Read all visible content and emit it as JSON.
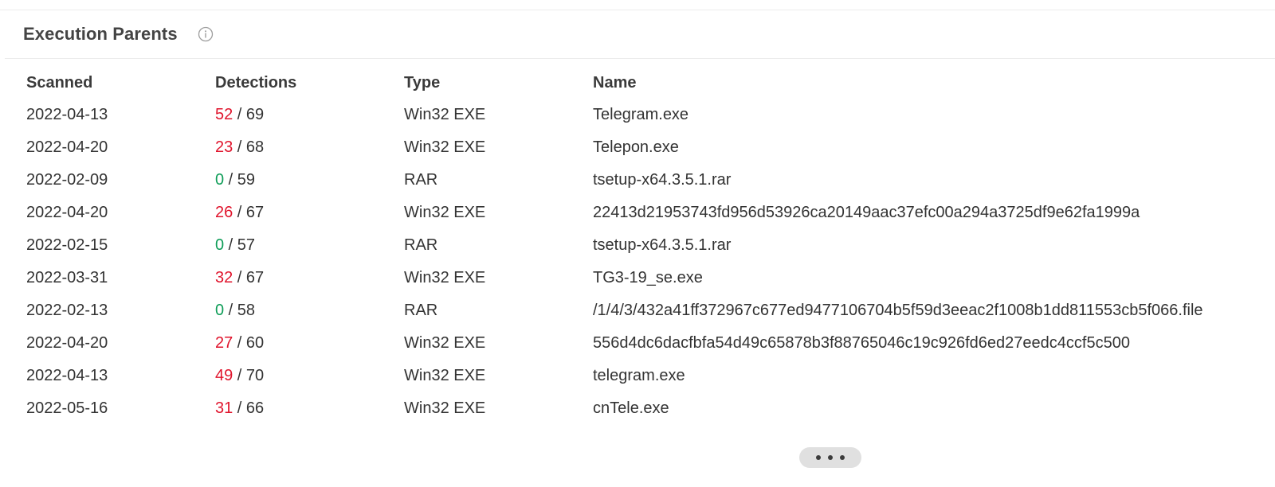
{
  "section": {
    "title": "Execution Parents",
    "info_icon": "info-circle-icon"
  },
  "table": {
    "columns": [
      "Scanned",
      "Detections",
      "Type",
      "Name"
    ],
    "rows": [
      {
        "scanned": "2022-04-13",
        "detected": "52",
        "total": "69",
        "type": "Win32 EXE",
        "name": "Telegram.exe"
      },
      {
        "scanned": "2022-04-20",
        "detected": "23",
        "total": "68",
        "type": "Win32 EXE",
        "name": "Telepon.exe"
      },
      {
        "scanned": "2022-02-09",
        "detected": "0",
        "total": "59",
        "type": "RAR",
        "name": "tsetup-x64.3.5.1.rar"
      },
      {
        "scanned": "2022-04-20",
        "detected": "26",
        "total": "67",
        "type": "Win32 EXE",
        "name": "22413d21953743fd956d53926ca20149aac37efc00a294a3725df9e62fa1999a"
      },
      {
        "scanned": "2022-02-15",
        "detected": "0",
        "total": "57",
        "type": "RAR",
        "name": "tsetup-x64.3.5.1.rar"
      },
      {
        "scanned": "2022-03-31",
        "detected": "32",
        "total": "67",
        "type": "Win32 EXE",
        "name": "TG3-19_se.exe"
      },
      {
        "scanned": "2022-02-13",
        "detected": "0",
        "total": "58",
        "type": "RAR",
        "name": "/1/4/3/432a41ff372967c677ed9477106704b5f59d3eeac2f1008b1dd811553cb5f066.file"
      },
      {
        "scanned": "2022-04-20",
        "detected": "27",
        "total": "60",
        "type": "Win32 EXE",
        "name": "556d4dc6dacfbfa54d49c65878b3f88765046c19c926fd6ed27eedc4ccf5c500"
      },
      {
        "scanned": "2022-04-13",
        "detected": "49",
        "total": "70",
        "type": "Win32 EXE",
        "name": "telegram.exe"
      },
      {
        "scanned": "2022-05-16",
        "detected": "31",
        "total": "66",
        "type": "Win32 EXE",
        "name": "cnTele.exe"
      }
    ]
  },
  "load_more": {
    "icon": "more-horizontal-icon"
  },
  "colors": {
    "malicious": "#e0142c",
    "clean": "#0f9d58"
  }
}
